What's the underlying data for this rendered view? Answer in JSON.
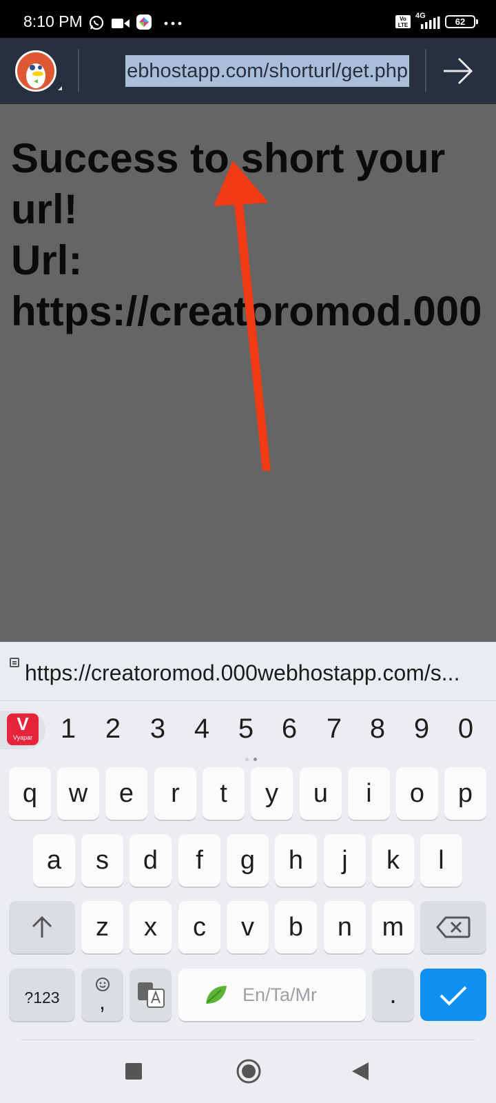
{
  "status_bar": {
    "time": "8:10 PM",
    "icons": [
      "whatsapp-icon",
      "video-camera-icon",
      "app-icon",
      "more-dots-icon"
    ],
    "volte_label": "Vo LTE",
    "network_label": "4G",
    "battery": "62"
  },
  "browser": {
    "logo": "duckduckgo-icon",
    "url": "ebhostapp.com/shorturl/get.php",
    "go_icon": "arrow-right-icon"
  },
  "page": {
    "line1": "Success to short your",
    "line2": "url!",
    "line3": "Url:",
    "line4": "https://creatoromod.000",
    "annotation_color": "#f23a14"
  },
  "suggestion": {
    "icon": "clipboard-icon",
    "text": "https://creatoromod.000webhostapp.com/s..."
  },
  "keyboard": {
    "vyapar_label": "Vyapar",
    "numbers": [
      "1",
      "2",
      "3",
      "4",
      "5",
      "6",
      "7",
      "8",
      "9",
      "0"
    ],
    "row1": [
      "q",
      "w",
      "e",
      "r",
      "t",
      "y",
      "u",
      "i",
      "o",
      "p"
    ],
    "row2": [
      "a",
      "s",
      "d",
      "f",
      "g",
      "h",
      "j",
      "k",
      "l"
    ],
    "row3": [
      "z",
      "x",
      "c",
      "v",
      "b",
      "n",
      "m"
    ],
    "symbols_label": "?123",
    "comma_label": ",",
    "space_label": "En/Ta/Mr",
    "period_label": ".",
    "accent_color": "#0f8ff2"
  },
  "nav": {
    "icons": [
      "recents-square-icon",
      "home-circle-icon",
      "back-triangle-icon"
    ]
  }
}
